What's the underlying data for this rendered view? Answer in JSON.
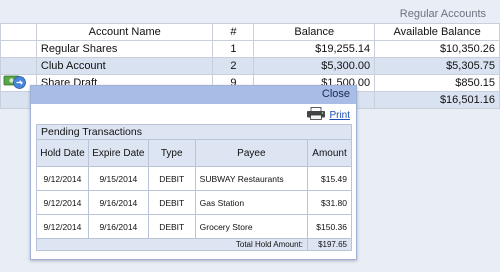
{
  "section_title": "Regular Accounts",
  "accounts": {
    "headers": [
      "Account Name",
      "#",
      "Balance",
      "Available Balance"
    ],
    "rows": [
      {
        "name": "Regular Shares",
        "num": "1",
        "balance": "$19,255.14",
        "available": "$10,350.26"
      },
      {
        "name": "Club Account",
        "num": "2",
        "balance": "$5,300.00",
        "available": "$5,305.75"
      },
      {
        "name": "Share Draft",
        "num": "9",
        "balance": "$1,500.00",
        "available": "$850.15"
      }
    ],
    "total_available": "$16,501.16"
  },
  "row_icon": "money-transfer-icon",
  "popup": {
    "close_label": "Close",
    "print_label": "Print",
    "print_icon": "printer-icon",
    "caption": "Pending Transactions",
    "headers": [
      "Hold Date",
      "Expire Date",
      "Type",
      "Payee",
      "Amount"
    ],
    "rows": [
      {
        "hold": "9/12/2014",
        "expire": "9/15/2014",
        "type": "DEBIT",
        "payee": "SUBWAY Restaurants",
        "amount": "$15.49"
      },
      {
        "hold": "9/12/2014",
        "expire": "9/16/2014",
        "type": "DEBIT",
        "payee": "Gas Station",
        "amount": "$31.80"
      },
      {
        "hold": "9/12/2014",
        "expire": "9/16/2014",
        "type": "DEBIT",
        "payee": "Grocery Store",
        "amount": "$150.36"
      }
    ],
    "total_label": "Total Hold Amount:",
    "total_value": "$197.65"
  }
}
